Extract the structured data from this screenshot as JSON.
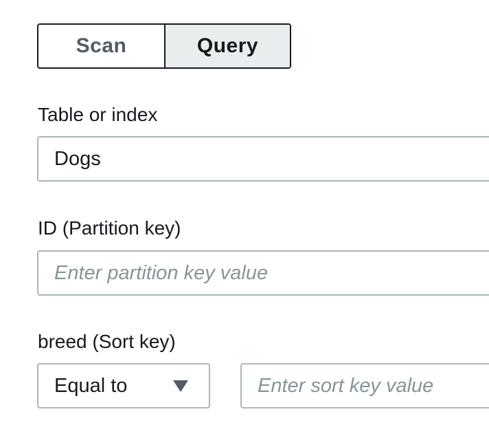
{
  "mode_toggle": {
    "scan_label": "Scan",
    "query_label": "Query",
    "selected": "Query"
  },
  "table": {
    "label": "Table or index",
    "value": "Dogs"
  },
  "partition_key": {
    "label": "ID (Partition key)",
    "placeholder": "Enter partition key value"
  },
  "sort_key": {
    "label": "breed (Sort key)",
    "operator": "Equal to",
    "placeholder": "Enter sort key value"
  },
  "colors": {
    "text": "#16191f",
    "border": "#aab7b8",
    "placeholder": "#879596",
    "selected_bg": "#eaeded"
  },
  "icons": {
    "operator_caret": "caret-down-icon"
  }
}
